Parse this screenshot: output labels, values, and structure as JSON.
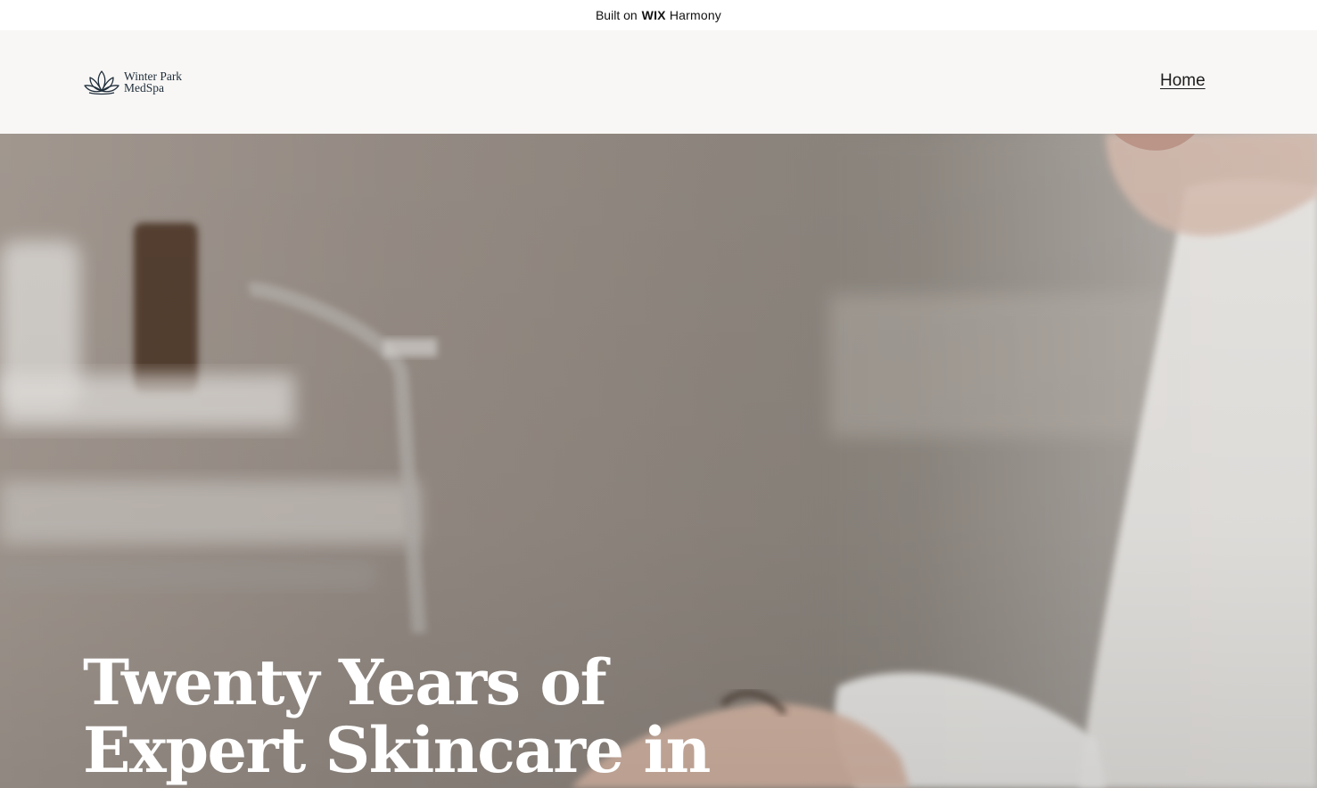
{
  "topbar": {
    "built_on": "Built on",
    "brand_wix": "WIX",
    "brand_harmony": "Harmony"
  },
  "header": {
    "logo": {
      "line1": "Winter Park",
      "line2": "MedSpa",
      "icon": "lotus-icon"
    },
    "nav": {
      "home_label": "Home"
    }
  },
  "hero": {
    "title": "Twenty Years of Expert Skincare in"
  },
  "colors": {
    "header_bg": "#f8f7f5",
    "logo_text": "#1f2d3a",
    "hero_text": "#ffffff"
  }
}
